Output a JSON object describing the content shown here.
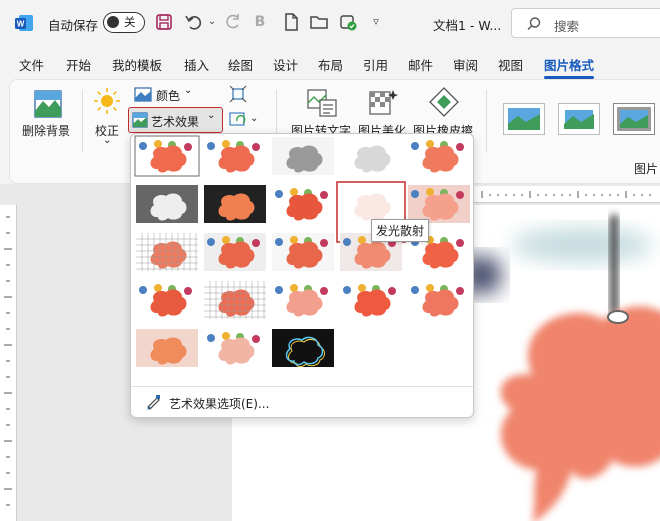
{
  "titlebar": {
    "autosave_label": "自动保存",
    "autosave_state": "关",
    "doc_title": "文档1  -  W...",
    "search_placeholder": "搜索",
    "quick_icons": [
      "save-icon",
      "undo-icon",
      "redo-icon",
      "bold-icon",
      "new-file-icon",
      "open-folder-icon",
      "sync-icon",
      "customize-icon"
    ]
  },
  "tabs": [
    {
      "label": "文件"
    },
    {
      "label": "开始"
    },
    {
      "label": "我的模板"
    },
    {
      "label": "插入"
    },
    {
      "label": "绘图"
    },
    {
      "label": "设计"
    },
    {
      "label": "布局"
    },
    {
      "label": "引用"
    },
    {
      "label": "邮件"
    },
    {
      "label": "审阅"
    },
    {
      "label": "视图"
    },
    {
      "label": "图片格式",
      "active": true
    }
  ],
  "ribbon": {
    "remove_bg": "删除背景",
    "correct": "校正",
    "color": "颜色",
    "art_effects": "艺术效果",
    "pic_to_text": "图片转文字",
    "pic_beautify": "图片美化",
    "pic_eraser": "图片橡皮擦",
    "group_label": "图片"
  },
  "gallery": {
    "hover_tooltip": "发光散射",
    "options_label": "艺术效果选项(E)...",
    "effect_count": 23
  },
  "colors": {
    "accent": "#185abd",
    "highlight_border": "#c42b2b",
    "cloud": "#f06a4d"
  }
}
